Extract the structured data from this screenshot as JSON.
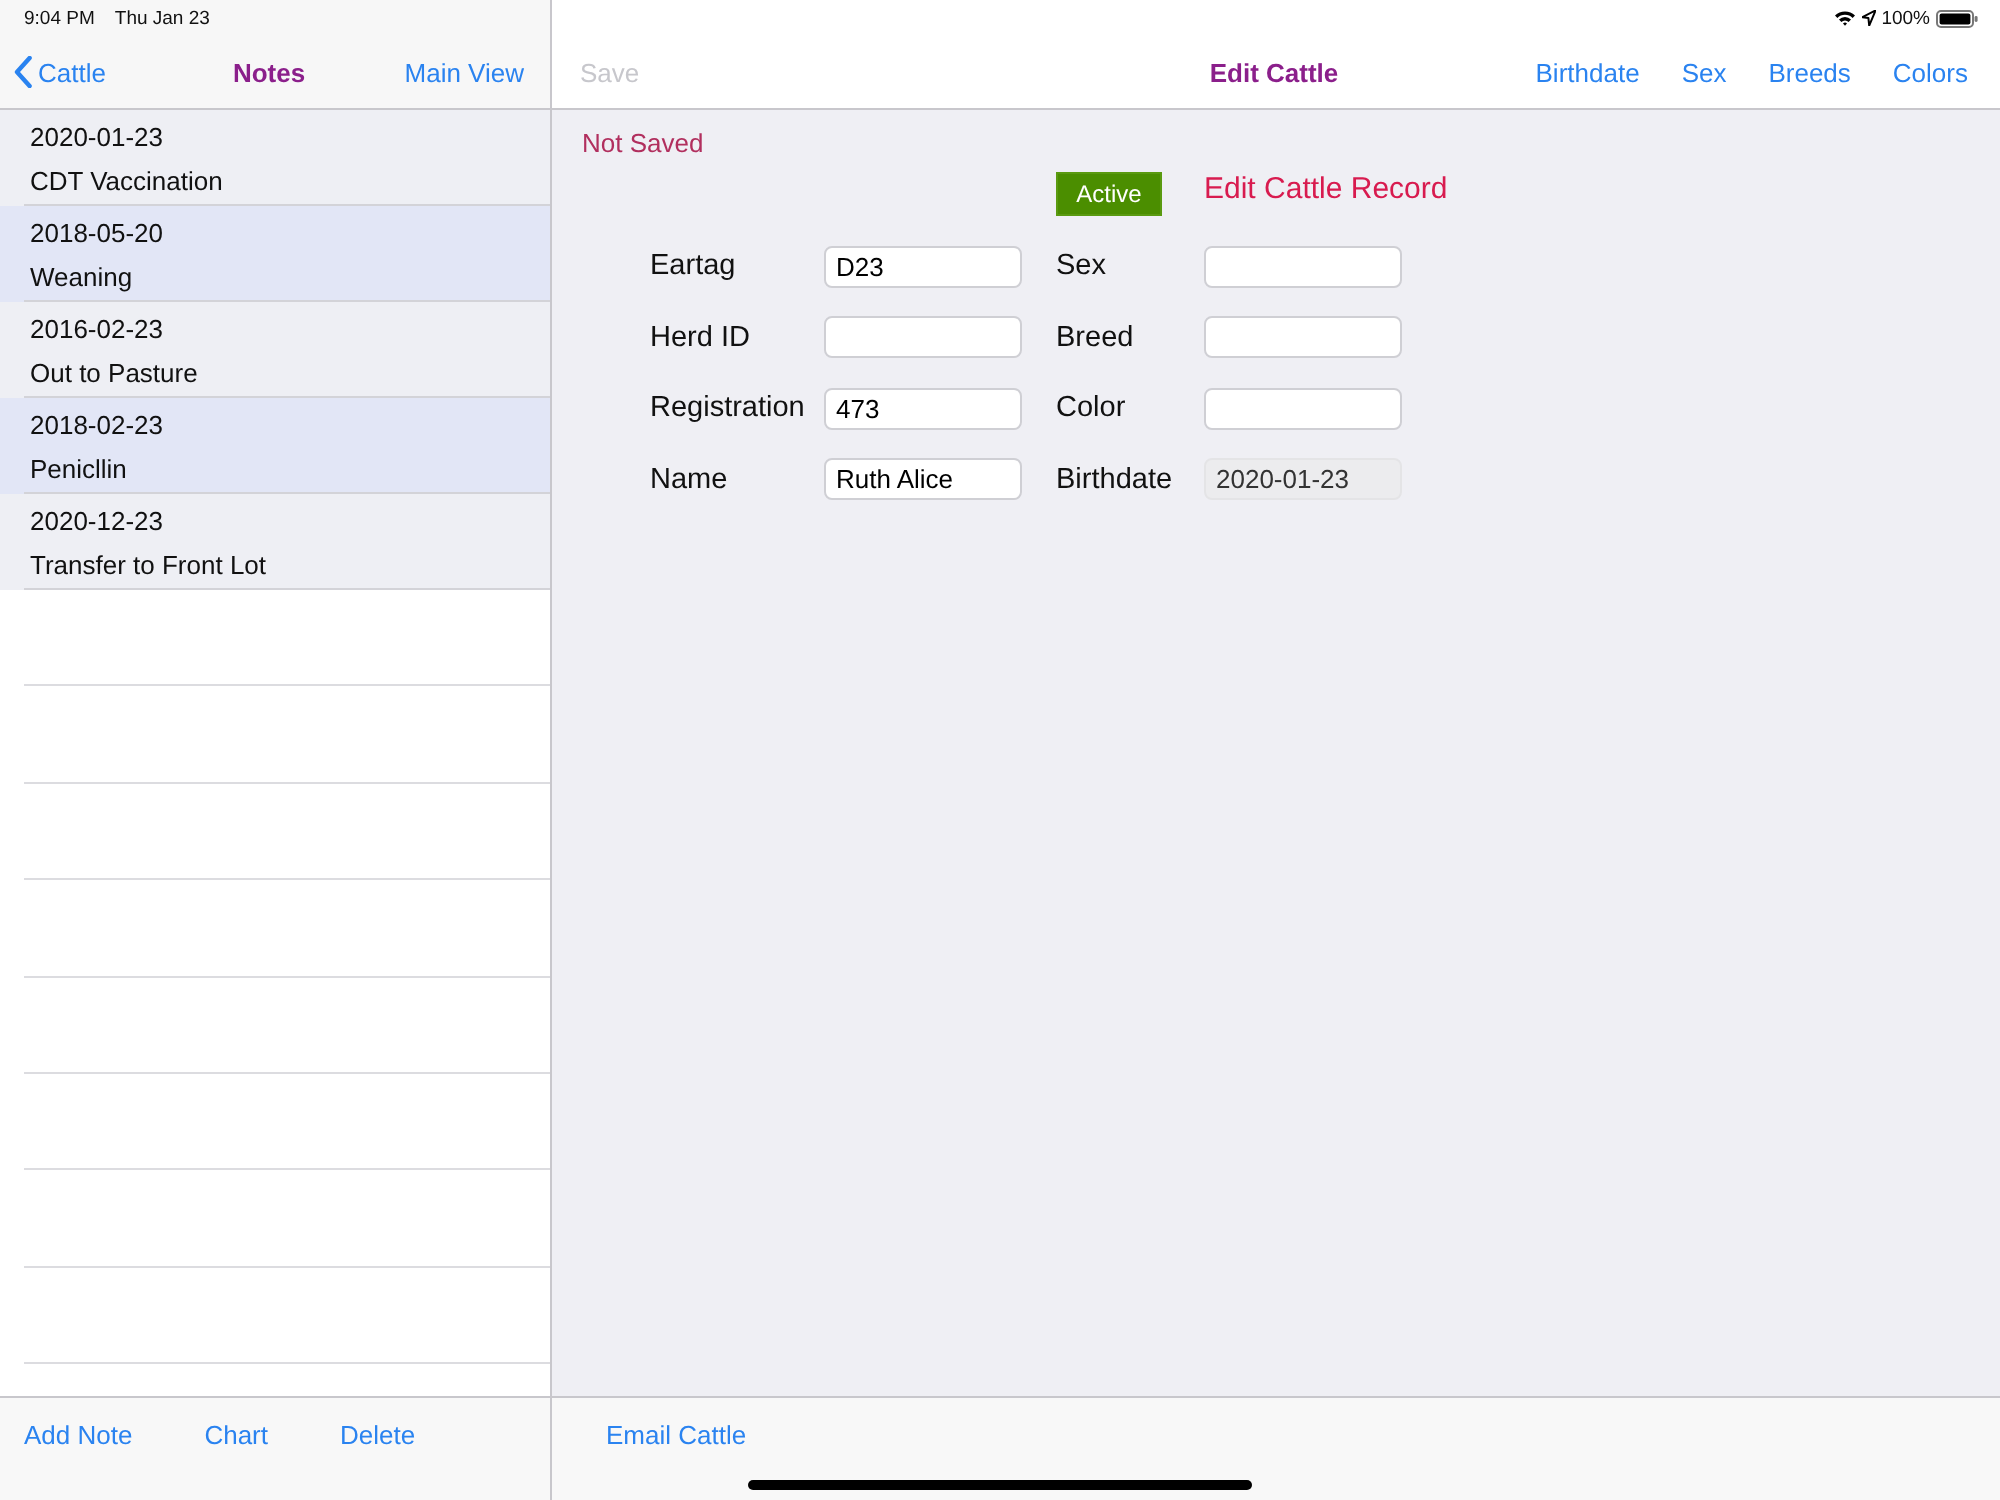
{
  "status_bar": {
    "time": "9:04 PM",
    "date": "Thu Jan 23",
    "battery": "100%"
  },
  "sidebar": {
    "back_button": "Cattle",
    "title": "Notes",
    "action": "Main View",
    "notes": [
      {
        "date": "2020-01-23",
        "text": "CDT Vaccination",
        "highlighted": false
      },
      {
        "date": "2018-05-20",
        "text": "Weaning",
        "highlighted": true
      },
      {
        "date": "2016-02-23",
        "text": "Out to Pasture",
        "highlighted": false
      },
      {
        "date": "2018-02-23",
        "text": "Penicllin",
        "highlighted": true
      },
      {
        "date": "2020-12-23",
        "text": "Transfer to Front Lot",
        "highlighted": false
      }
    ],
    "toolbar": [
      "Add Note",
      "Chart",
      "Delete"
    ]
  },
  "editor": {
    "save_button": {
      "label": "Save",
      "disabled": true
    },
    "title": "Edit Cattle",
    "nav_buttons": [
      "Birthdate",
      "Sex",
      "Breeds",
      "Colors"
    ],
    "status": "Not Saved",
    "active_badge": {
      "label": "Active",
      "on": true
    },
    "heading": "Edit Cattle Record",
    "fields": [
      {
        "label": "Eartag",
        "value": "D23",
        "disabled": false
      },
      {
        "label": "Sex",
        "disabled": false
      },
      {
        "label": "Herd ID",
        "disabled": false
      },
      {
        "label": "Breed",
        "disabled": false
      },
      {
        "label": "Registration",
        "value": "473",
        "disabled": false
      },
      {
        "label": "Color",
        "disabled": false
      },
      {
        "label": "Name",
        "value": "Ruth Alice",
        "disabled": false
      },
      {
        "label": "Birthdate",
        "value": "2020-01-23",
        "disabled": true
      }
    ],
    "toolbar": [
      "Email Cattle"
    ]
  }
}
